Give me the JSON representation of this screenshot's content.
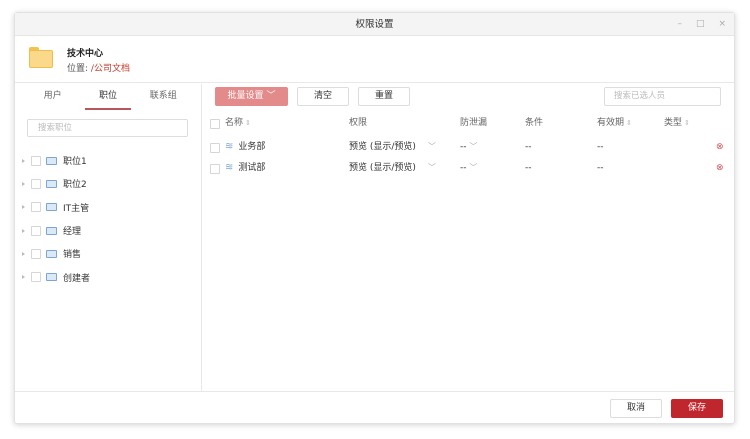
{
  "window": {
    "title": "权限设置",
    "minimize": "–",
    "maximize": "□",
    "close": "×"
  },
  "header": {
    "name": "技术中心",
    "location_label": "位置: ",
    "location_path": "/公司文档"
  },
  "left": {
    "tabs": [
      {
        "label": "用户"
      },
      {
        "label": "职位",
        "active": true
      },
      {
        "label": "联系组"
      }
    ],
    "search_placeholder": "搜索职位",
    "items": [
      {
        "label": "职位1"
      },
      {
        "label": "职位2"
      },
      {
        "label": "IT主管"
      },
      {
        "label": "经理"
      },
      {
        "label": "销售"
      },
      {
        "label": "创建者"
      }
    ]
  },
  "toolbar": {
    "batch": "批量设置",
    "clear": "清空",
    "reset": "重置",
    "search_placeholder": "搜索已选人员"
  },
  "table": {
    "columns": {
      "name": "名称",
      "permission": "权限",
      "leak": "防泄漏",
      "condition": "条件",
      "validity": "有效期",
      "type": "类型"
    },
    "rows": [
      {
        "name": "业务部",
        "permission": "预览 (显示/预览)",
        "leak": "--",
        "condition": "--",
        "validity": "--"
      },
      {
        "name": "测试部",
        "permission": "预览 (显示/预览)",
        "leak": "--",
        "condition": "--",
        "validity": "--"
      }
    ]
  },
  "footer": {
    "cancel": "取消",
    "save": "保存"
  },
  "colors": {
    "accent": "#c0262e",
    "batch": "#e38a8a"
  }
}
